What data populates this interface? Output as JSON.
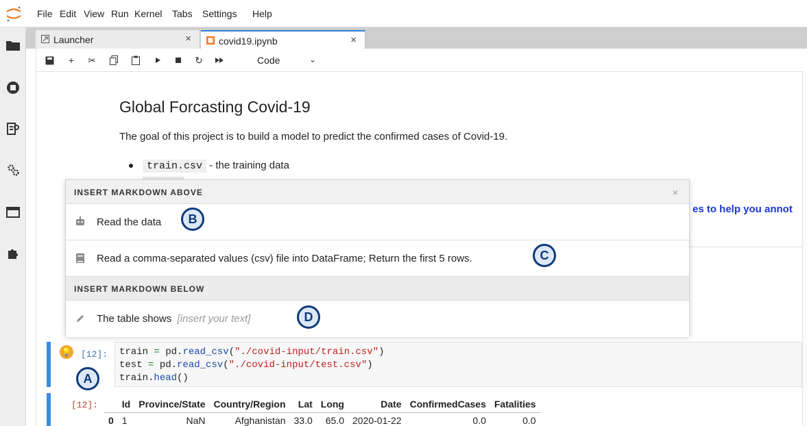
{
  "menubar": {
    "items": [
      "File",
      "Edit",
      "View",
      "Run",
      "Kernel",
      "Tabs",
      "Settings",
      "Help"
    ]
  },
  "sidebar": {
    "icons": [
      "folder-icon",
      "running-icon",
      "commands-icon",
      "property-inspector-icon",
      "tabs-icon",
      "extension-icon"
    ]
  },
  "tabs": [
    {
      "label": "Launcher",
      "icon": "launcher-icon",
      "active": false
    },
    {
      "label": "covid19.ipynb",
      "icon": "notebook-icon",
      "active": true
    }
  ],
  "toolbar": {
    "cell_type": "Code",
    "buttons": [
      "save-icon",
      "add-icon",
      "cut-icon",
      "copy-icon",
      "paste-icon",
      "run-icon",
      "stop-icon",
      "restart-icon",
      "fast-forward-icon"
    ]
  },
  "notebook": {
    "title": "Global Forcasting Covid-19",
    "paragraph": "The goal of this project is to build a model to predict the confirmed cases of Covid-19.",
    "bullet_code": "train.csv",
    "bullet_text": " - the training data",
    "right_text": "es to help you annot"
  },
  "popup": {
    "header_above": "INSERT MARKDOWN ABOVE",
    "close": "×",
    "row1": "Read the data",
    "row2": "Read a comma-separated values (csv) file into DataFrame; Return the first 5 rows.",
    "header_below": "INSERT MARKDOWN BELOW",
    "row3_text": "The table shows",
    "row3_placeholder": "[insert your text]"
  },
  "markers": {
    "a": "A",
    "b": "B",
    "c": "C",
    "d": "D"
  },
  "cell": {
    "prompt_in": "[12]:",
    "prompt_out": "[12]:",
    "lines": [
      "train = pd.read_csv(\"./covid-input/train.csv\")",
      "test = pd.read_csv(\"./covid-input/test.csv\")",
      "train.head()"
    ]
  },
  "table": {
    "columns": [
      "",
      "Id",
      "Province/State",
      "Country/Region",
      "Lat",
      "Long",
      "Date",
      "ConfirmedCases",
      "Fatalities"
    ],
    "rows": [
      [
        "0",
        "1",
        "NaN",
        "Afghanistan",
        "33.0",
        "65.0",
        "2020-01-22",
        "0.0",
        "0.0"
      ]
    ]
  },
  "colors": {
    "accent": "#2f80d1",
    "cell_bar": "#3c8be0",
    "marker": "#0d3a7a",
    "link": "#1a37d6"
  }
}
